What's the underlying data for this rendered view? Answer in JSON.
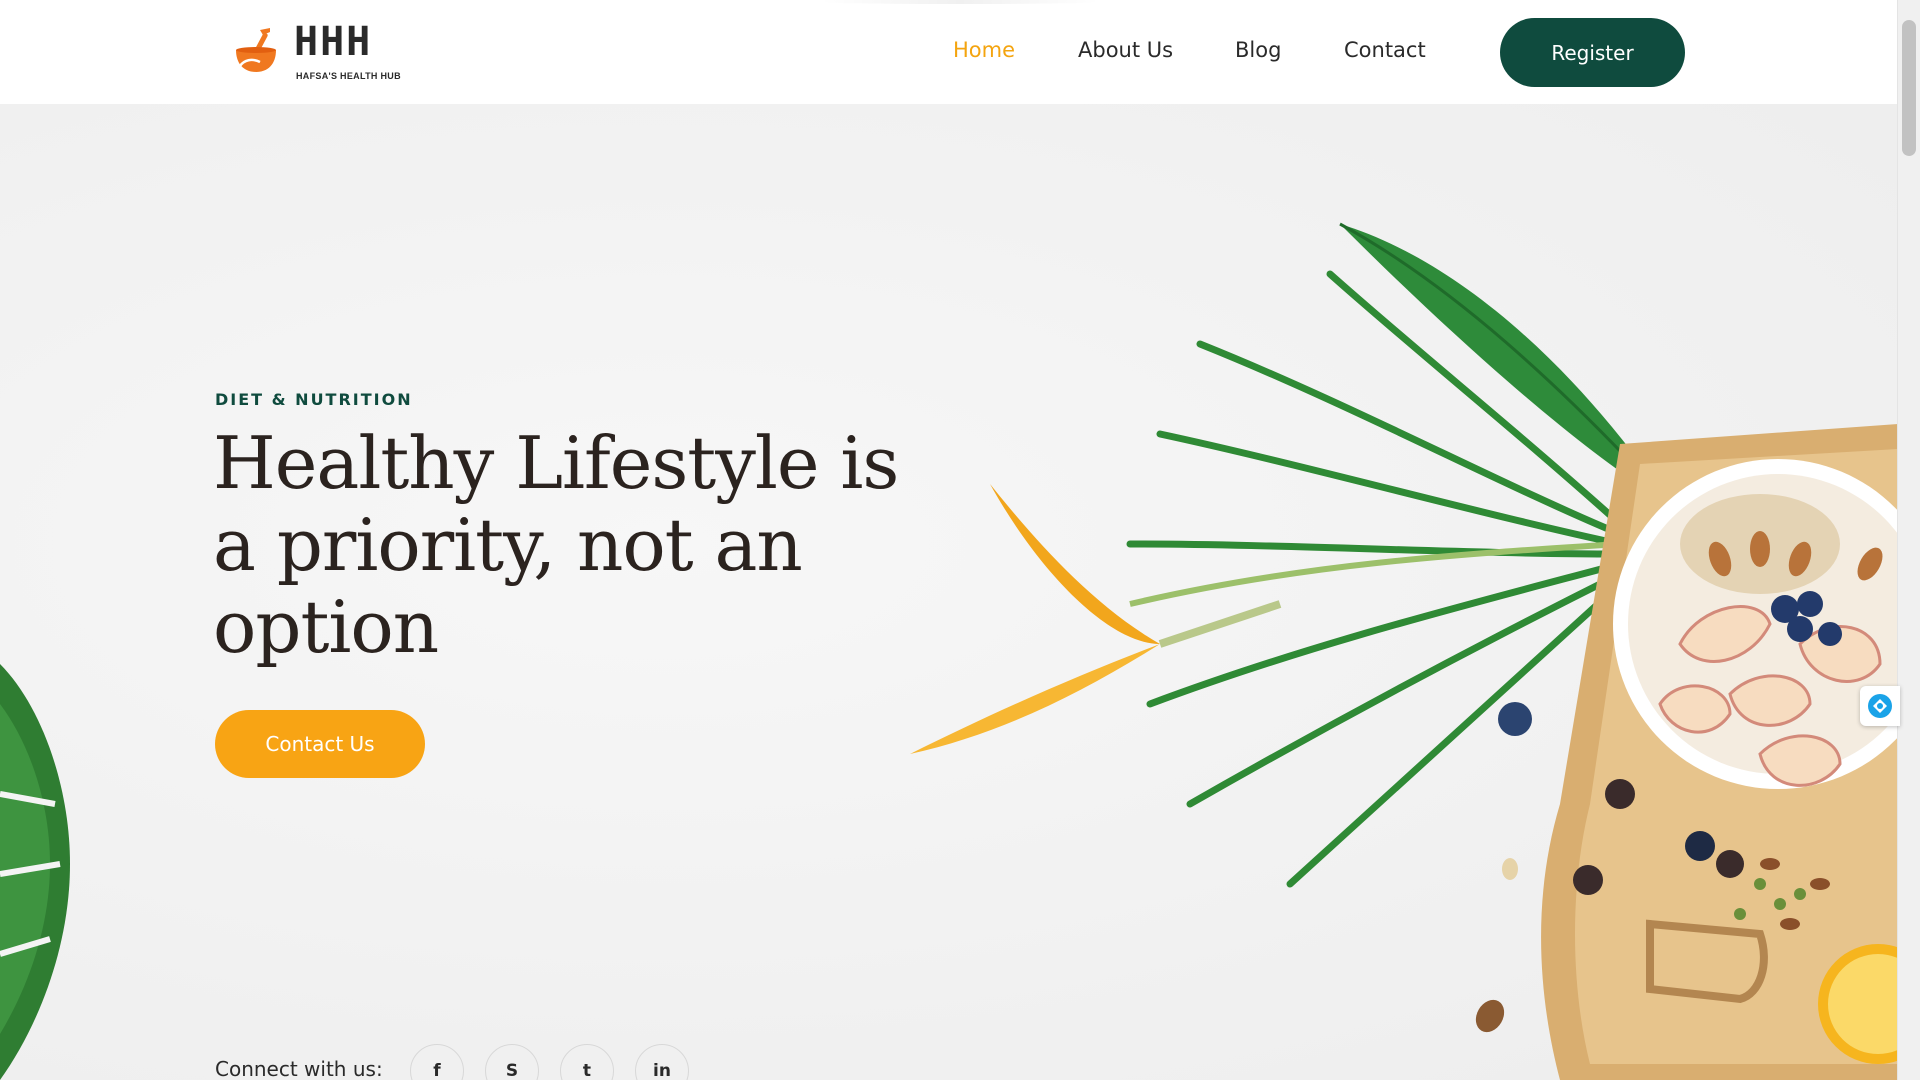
{
  "brand": {
    "letters": "HHH",
    "tagline": "HAFSA'S HEALTH HUB",
    "accent_color": "#f4a40f",
    "primary_color": "#0f4b3e"
  },
  "nav": {
    "items": [
      {
        "label": "Home",
        "active": true
      },
      {
        "label": "About Us",
        "active": false
      },
      {
        "label": "Blog",
        "active": false
      },
      {
        "label": "Contact",
        "active": false
      }
    ],
    "register_label": "Register"
  },
  "hero": {
    "eyebrow": "DIET & NUTRITION",
    "headline_line1": "Healthy Lifestyle is",
    "headline_line2": "a priority, not an",
    "headline_line3": "option",
    "cta_label": "Contact Us",
    "connect_label": "Connect with us:"
  },
  "social": {
    "links": [
      {
        "icon": "facebook-icon",
        "glyph": "f"
      },
      {
        "icon": "skype-icon",
        "glyph": "S"
      },
      {
        "icon": "twitter-icon",
        "glyph": "t"
      },
      {
        "icon": "linkedin-icon",
        "glyph": "in"
      }
    ]
  },
  "widgets": {
    "chat_icon": "chat-bubble-icon"
  }
}
